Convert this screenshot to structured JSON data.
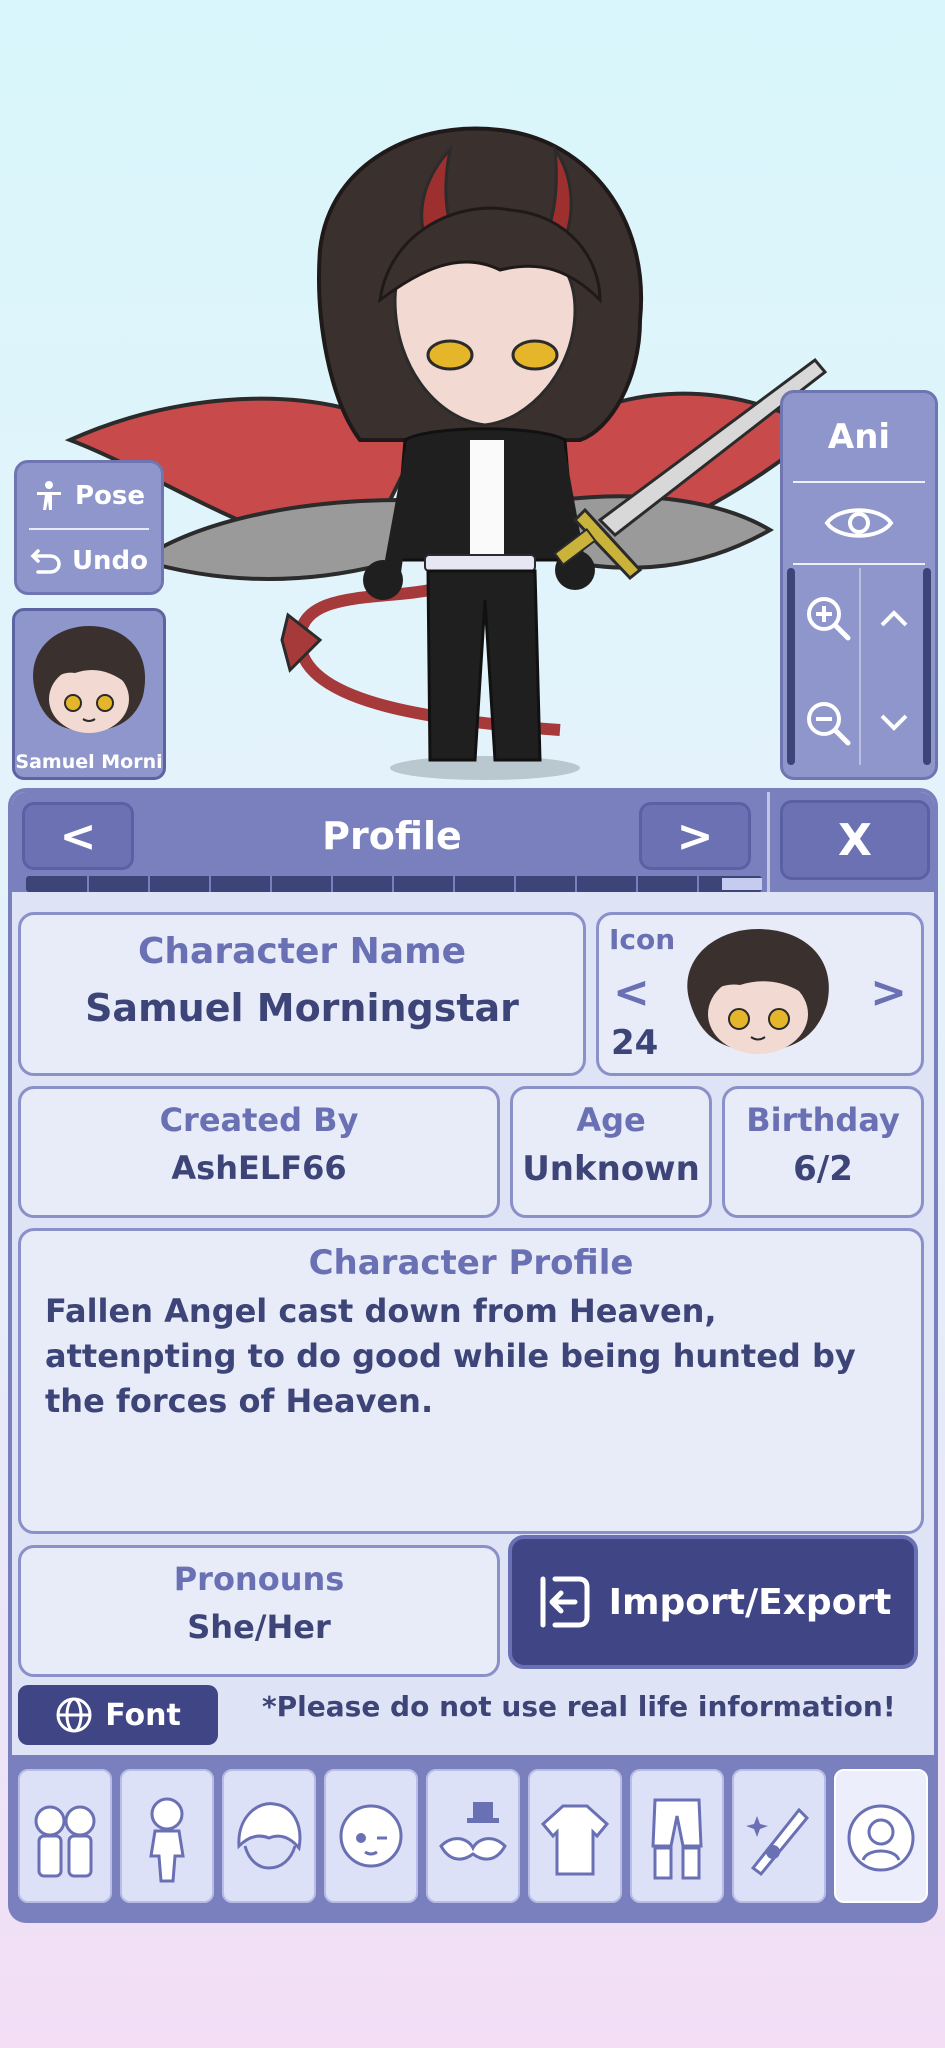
{
  "stage": {
    "pose_label": "Pose",
    "undo_label": "Undo",
    "character_thumb_name": "Samuel Morni",
    "ani_label": "Ani"
  },
  "header": {
    "prev_label": "<",
    "title": "Profile",
    "next_label": ">",
    "close_label": "X"
  },
  "profile": {
    "name_label": "Character Name",
    "name_value": "Samuel Morningstar",
    "icon_label": "Icon",
    "icon_prev": "<",
    "icon_next": ">",
    "icon_number": "24",
    "created_label": "Created By",
    "created_value": "AshELF66",
    "age_label": "Age",
    "age_value": "Unknown",
    "birthday_label": "Birthday",
    "birthday_value": "6/2",
    "bio_label": "Character Profile",
    "bio_text": "Fallen Angel cast down from Heaven, attenpting to do good while being hunted by the forces of Heaven.",
    "pronouns_label": "Pronouns",
    "pronouns_value": "She/Her",
    "import_export_label": "Import/Export"
  },
  "footer": {
    "font_label": "Font",
    "note": "*Please do not use real life information!"
  },
  "tabs": [
    {
      "icon": "characters-icon"
    },
    {
      "icon": "body-icon"
    },
    {
      "icon": "hair-icon"
    },
    {
      "icon": "face-icon"
    },
    {
      "icon": "accessories-icon"
    },
    {
      "icon": "top-icon"
    },
    {
      "icon": "bottom-icon"
    },
    {
      "icon": "props-icon"
    },
    {
      "icon": "profile-icon"
    }
  ],
  "colors": {
    "panel": "#7a80be",
    "panel_dark": "#3f4585",
    "card_bg": "#e8ebf8",
    "accent_text": "#6a70b4",
    "text": "#3d4478"
  }
}
